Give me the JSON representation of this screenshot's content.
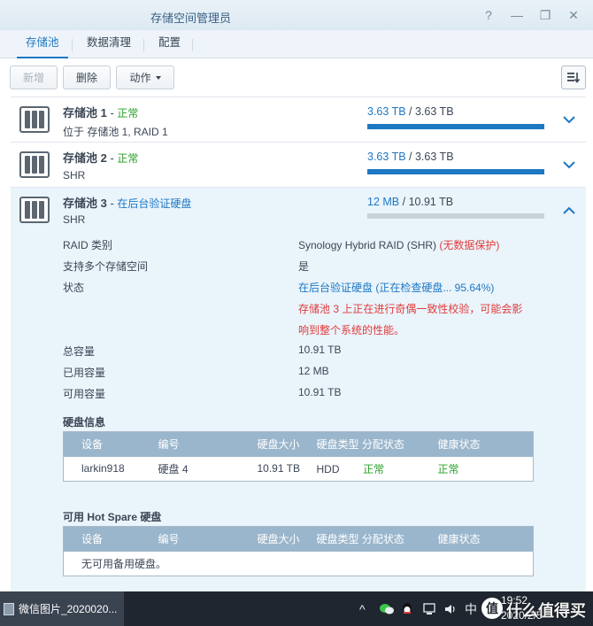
{
  "window": {
    "title": "存储空间管理员",
    "controls": [
      "?",
      "—",
      "❐",
      "✕"
    ]
  },
  "tabs": [
    {
      "label": "存储池",
      "active": true
    },
    {
      "label": "数据清理",
      "active": false
    },
    {
      "label": "配置",
      "active": false
    }
  ],
  "toolbar": {
    "create_label": "新增",
    "delete_label": "删除",
    "action_label": "动作"
  },
  "pools": [
    {
      "name": "存储池 1",
      "dash": " - ",
      "state": "正常",
      "subtitle": "位于 存储池 1, RAID 1",
      "used": "3.63 TB",
      "sep": " / ",
      "total": "3.63 TB",
      "usage_fraction": 1.0,
      "expanded": false
    },
    {
      "name": "存储池 2",
      "dash": " - ",
      "state": "正常",
      "subtitle": "SHR",
      "used": "3.63 TB",
      "sep": " / ",
      "total": "3.63 TB",
      "usage_fraction": 1.0,
      "expanded": false
    },
    {
      "name": "存储池 3",
      "dash": " - ",
      "state": "在后台验证硬盘",
      "subtitle": "SHR",
      "used": "12 MB",
      "sep": " / ",
      "total": "10.91 TB",
      "usage_fraction": 0.0,
      "expanded": true
    }
  ],
  "details": {
    "raid_type_label": "RAID 类别",
    "raid_type_value": "Synology Hybrid RAID (SHR)",
    "raid_type_note": "(无数据保护)",
    "multi_volume_label": "支持多个存储空间",
    "multi_volume_value": "是",
    "status_label": "状态",
    "status_value": "在后台验证硬盘 (正在检查硬盘... 95.64%)",
    "status_warning_line1": "存储池 3 上正在进行奇偶一致性校验，可能会影",
    "status_warning_line2": "响到整个系统的性能。",
    "total_label": "总容量",
    "total_value": "10.91 TB",
    "used_label": "已用容量",
    "used_value": "12 MB",
    "available_label": "可用容量",
    "available_value": "10.91 TB"
  },
  "disk_info": {
    "title": "硬盘信息",
    "columns": [
      "设备",
      "编号",
      "硬盘大小",
      "硬盘类型",
      "分配状态",
      "健康状态"
    ],
    "rows": [
      [
        "larkin918",
        "硬盘 4",
        "10.91 TB",
        "HDD",
        "正常",
        "正常"
      ]
    ]
  },
  "hot_spare": {
    "title": "可用 Hot Spare 硬盘",
    "columns": [
      "设备",
      "编号",
      "硬盘大小",
      "硬盘类型",
      "分配状态",
      "健康状态"
    ],
    "empty_text": "无可用备用硬盘。"
  },
  "taskbar": {
    "app_label": "微信图片_2020020...",
    "ime": "中",
    "time": "19:52",
    "date": "2020/2/5"
  },
  "watermark": {
    "badge": "值",
    "text": "什么值得买"
  },
  "colors": {
    "accent": "#1d78c4",
    "ok": "#2aa02a",
    "warning": "#e03c3c",
    "table_header": "#9ab6cc",
    "expanded_bg": "#eaf4fb"
  }
}
